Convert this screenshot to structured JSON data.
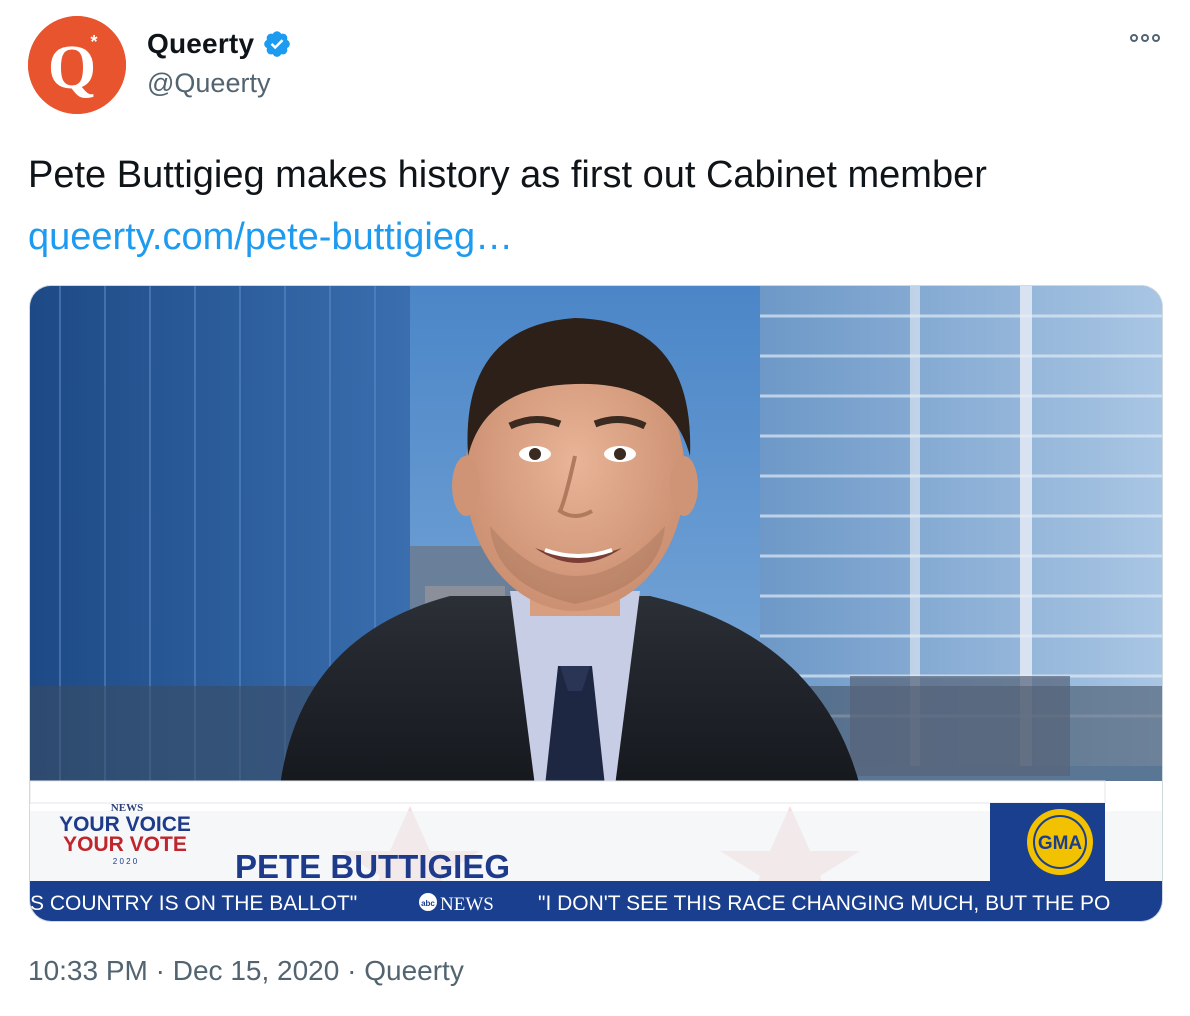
{
  "author": {
    "display_name": "Queerty",
    "handle": "@Queerty",
    "avatar_letter": "Q",
    "verified": true,
    "brand_color": "#e8542d"
  },
  "tweet": {
    "text": "Pete Buttigieg makes history as first out Cabinet member",
    "link_text": "queerty.com/pete-buttigieg…",
    "time": "10:33 PM",
    "date": "Dec 15, 2020",
    "source": "Queerty",
    "separator": "·"
  },
  "media": {
    "lower_third_name": "PETE BUTTIGIEG",
    "ticker_left": "S COUNTRY IS ON THE BALLOT\"",
    "ticker_network": "NEWS",
    "ticker_right": "\"I DON'T SEE THIS RACE CHANGING MUCH, BUT THE PO",
    "badge": "GMA",
    "brand_line_1": "YOUR VOICE",
    "brand_line_2": "YOUR VOTE",
    "brand_year": "2 0 2 0",
    "brand_network": "NEWS"
  },
  "icons": {
    "more": "more-horizontal-icon",
    "verified": "verified-badge-icon"
  }
}
